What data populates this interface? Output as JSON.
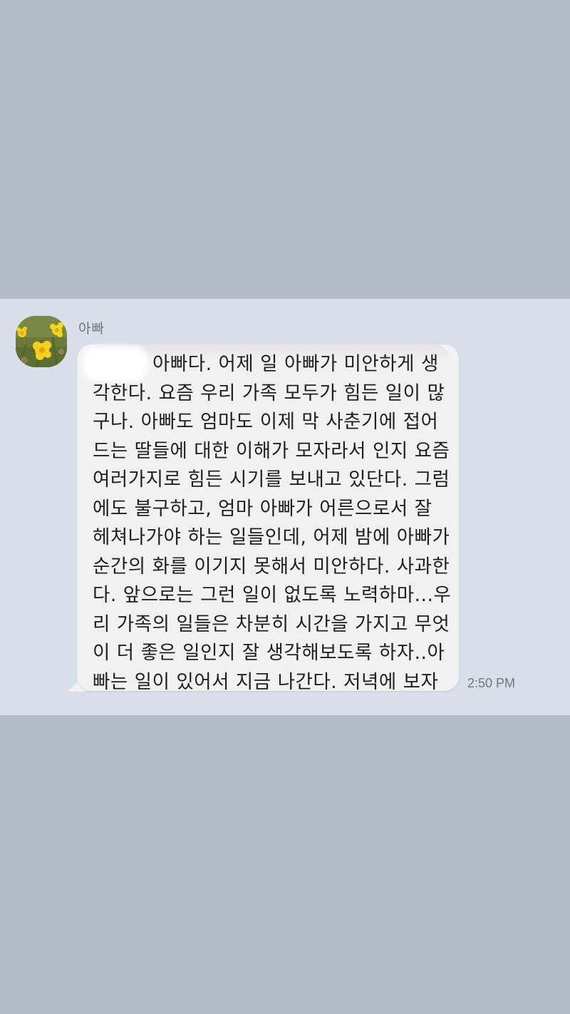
{
  "chat": {
    "sender_name": "아빠",
    "message": {
      "lines": [
        "아빠다. 어제 일 아빠가 미안하게 생",
        "각한다. 요즘 우리 가족 모두가 힘든 일이 많",
        "구나. 아빠도 엄마도 이제 막 사춘기에 접어",
        "드는 딸들에 대한 이해가 모자라서 인지 요즘",
        "여러가지로 힘든 시기를 보내고 있단다. 그럼",
        "에도 불구하고, 엄마 아빠가 어른으로서 잘",
        "헤쳐나가야 하는 일들인데, 어제 밤에 아빠가",
        "순간의 화를 이기지 못해서 미안하다. 사과한",
        "다. 앞으로는 그런 일이 없도록 노력하마...우",
        "리 가족의 일들은 차분히 시간을 가지고 무엇",
        "이 더 좋은 일인지 잘 생각해보도록 하자..아",
        "빠는 일이 있어서 지금 나간다. 저녁에 보자"
      ],
      "timestamp": "2:50 PM"
    }
  },
  "colors": {
    "outer_background": "#b3bcc7",
    "chat_background": "#d8dfea",
    "bubble": "#f1f1f1",
    "text": "#1f1f1f",
    "meta_text": "#6f7682"
  },
  "icons": {
    "avatar": "daffodil-flower-photo"
  }
}
